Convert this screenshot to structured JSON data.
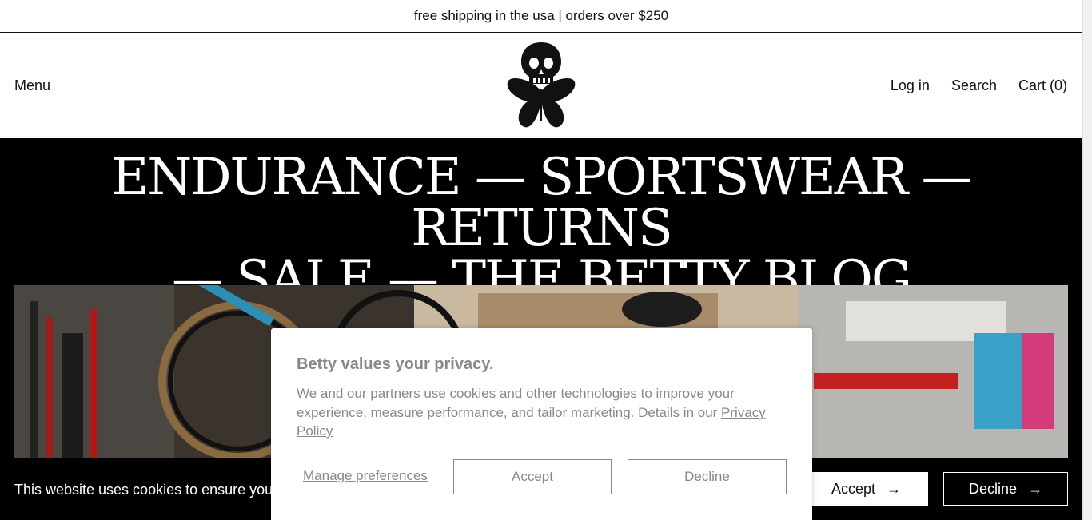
{
  "announcement": {
    "text": "free shipping in the usa | orders over $250"
  },
  "header": {
    "menu_label": "Menu",
    "logo_icon": "skull-butterfly-icon",
    "login_label": "Log in",
    "search_label": "Search",
    "cart_label": "Cart (0)"
  },
  "nav": {
    "items": [
      "ENDURANCE",
      "SPORTSWEAR",
      "RETURNS",
      "SALE",
      "THE BETTY BLOG"
    ],
    "separator": "—"
  },
  "cookie_bar": {
    "message": "This website uses cookies to ensure you g",
    "accept_label": "Accept",
    "decline_label": "Decline",
    "arrow": "→"
  },
  "privacy_modal": {
    "title": "Betty values your privacy.",
    "body": "We and our partners use cookies and other technologies to improve your experience, measure performance, and tailor marketing. Details in our ",
    "link_label": "Privacy Policy",
    "manage_label": "Manage preferences",
    "accept_label": "Accept",
    "decline_label": "Decline"
  },
  "colors": {
    "background": "#000000",
    "modal_text": "#888888",
    "foreground": "#111111"
  }
}
